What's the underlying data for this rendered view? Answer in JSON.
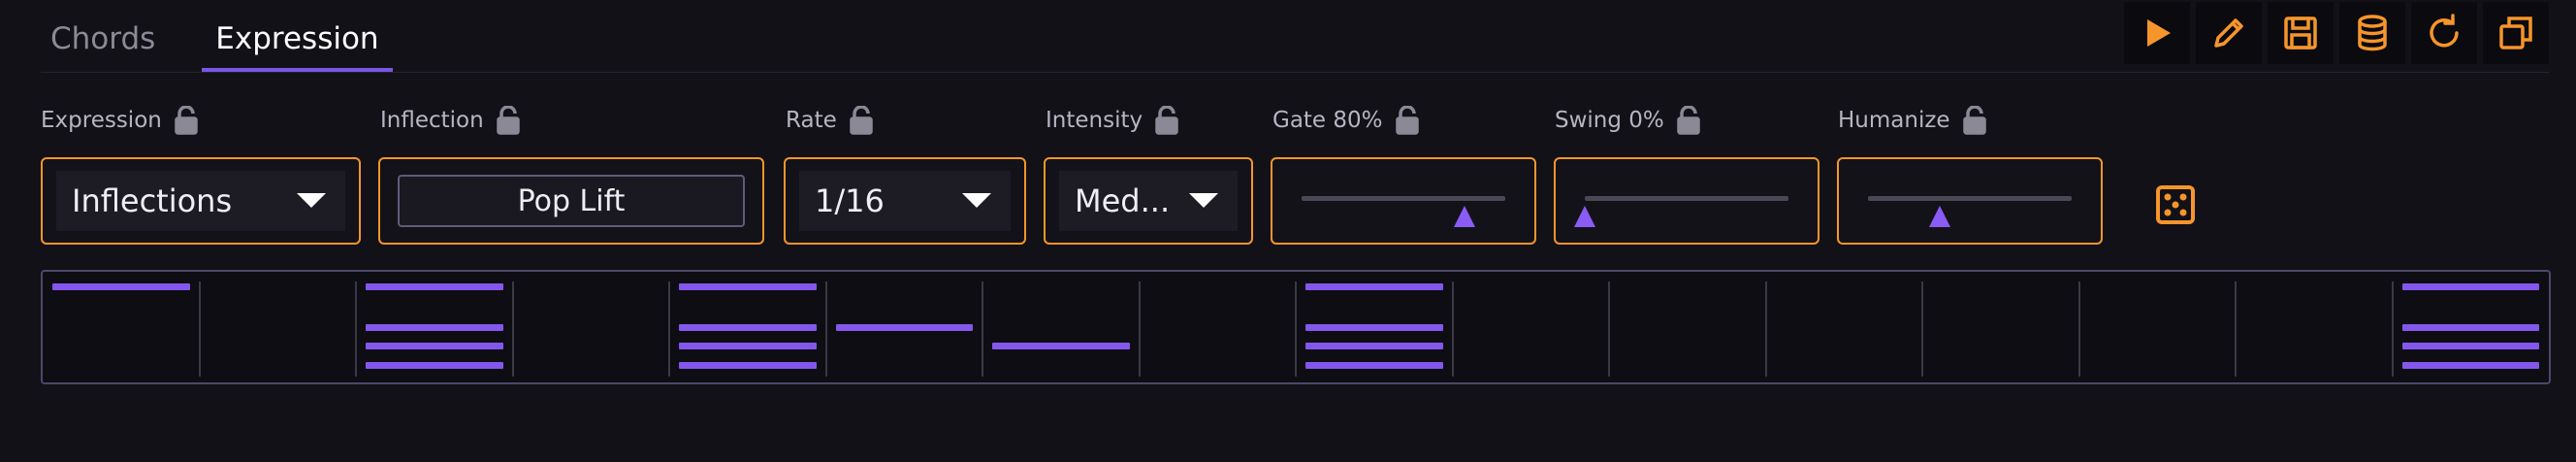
{
  "tabs": [
    {
      "label": "Chords",
      "active": false
    },
    {
      "label": "Expression",
      "active": true
    }
  ],
  "toolbar": {
    "icons": [
      "play-icon",
      "pencil-icon",
      "save-icon",
      "database-icon",
      "refresh-icon",
      "duplicate-icon"
    ],
    "accent": "#f6952b"
  },
  "controls": {
    "expression": {
      "label": "Expression",
      "value": "Inflections"
    },
    "inflection": {
      "label": "Inflection",
      "value": "Pop Lift"
    },
    "rate": {
      "label": "Rate",
      "value": "1/16"
    },
    "intensity": {
      "label": "Intensity",
      "value": "Med..."
    },
    "gate": {
      "label": "Gate 80%",
      "level": 0.8
    },
    "swing": {
      "label": "Swing 0%",
      "level": 0.0
    },
    "humanize": {
      "label": "Humanize",
      "level": 0.35
    }
  },
  "colors": {
    "accent": "#f6952b",
    "note": "#8457ec",
    "background": "#121118"
  },
  "pattern": {
    "steps": 16,
    "columns": [
      [
        0
      ],
      [],
      [
        0,
        2,
        3,
        4
      ],
      [],
      [
        0,
        2,
        3,
        4
      ],
      [
        2
      ],
      [
        3
      ],
      [],
      [
        0,
        2,
        3,
        4
      ],
      [],
      [],
      [],
      [],
      [],
      [],
      [
        0,
        2,
        3,
        4
      ]
    ]
  }
}
